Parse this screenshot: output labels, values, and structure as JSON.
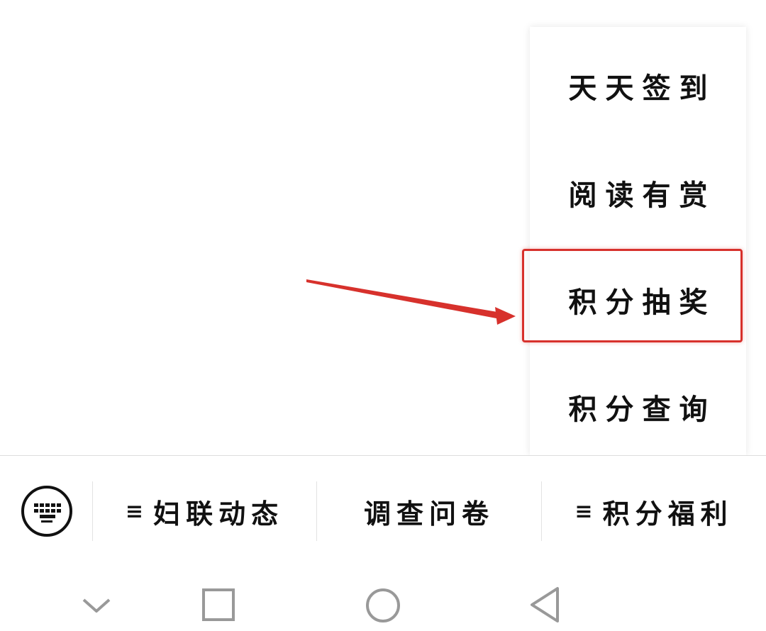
{
  "submenu": {
    "items": [
      {
        "label": "天天签到"
      },
      {
        "label": "阅读有赏"
      },
      {
        "label": "积分抽奖",
        "highlighted": true
      },
      {
        "label": "积分查询"
      }
    ]
  },
  "annotation": {
    "color": "#d7312c"
  },
  "menu_bar": {
    "keyboard_icon": "keyboard-icon",
    "buttons": [
      {
        "label": "妇联动态",
        "icon": "menu-lines-icon",
        "icon_glyph": "≡"
      },
      {
        "label": "调查问卷"
      },
      {
        "label": "积分福利",
        "icon": "menu-lines-icon",
        "icon_glyph": "≡"
      }
    ]
  },
  "nav_bar": {
    "icons": [
      "chevron-down-icon",
      "square-recents-icon",
      "circle-home-icon",
      "triangle-back-icon"
    ]
  }
}
